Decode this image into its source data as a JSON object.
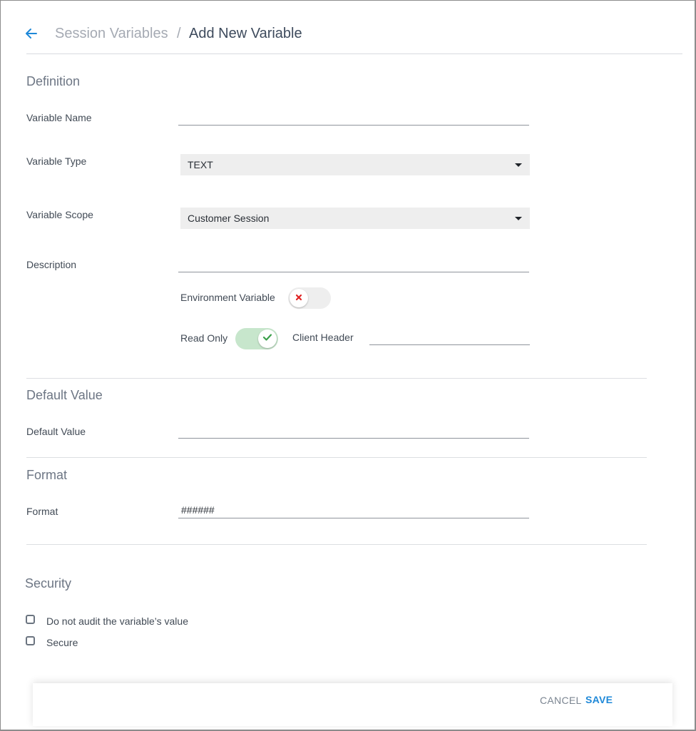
{
  "breadcrumb": {
    "parent": "Session Variables",
    "separator": "/",
    "current": "Add New Variable"
  },
  "definition": {
    "title": "Definition",
    "variable_name": {
      "label": "Variable Name",
      "value": ""
    },
    "variable_type": {
      "label": "Variable Type",
      "value": "TEXT"
    },
    "variable_scope": {
      "label": "Variable Scope",
      "value": "Customer Session"
    },
    "description": {
      "label": "Description",
      "value": ""
    },
    "environment_variable": {
      "label": "Environment Variable",
      "state": "off"
    },
    "read_only": {
      "label": "Read Only",
      "state": "on"
    },
    "client_header": {
      "label": "Client Header",
      "value": ""
    }
  },
  "default_value": {
    "title": "Default Value",
    "field": {
      "label": "Default Value",
      "value": ""
    }
  },
  "format": {
    "title": "Format",
    "field": {
      "label": "Format",
      "value": "######"
    }
  },
  "security": {
    "title": "Security",
    "options": [
      {
        "label": "Do not audit the variable’s value",
        "checked": false
      },
      {
        "label": "Secure",
        "checked": false
      }
    ]
  },
  "footer": {
    "cancel_label": "CANCEL",
    "save_label": "SAVE"
  },
  "colors": {
    "accent": "#1e88d8",
    "toggle_on": "#c7e6cc",
    "check_green": "#3aa04a",
    "cross_red": "#e02424"
  },
  "icons": {
    "back": "arrow-left-icon",
    "dropdown": "caret-down-icon",
    "toggle_off": "x-icon",
    "toggle_on": "check-icon"
  }
}
